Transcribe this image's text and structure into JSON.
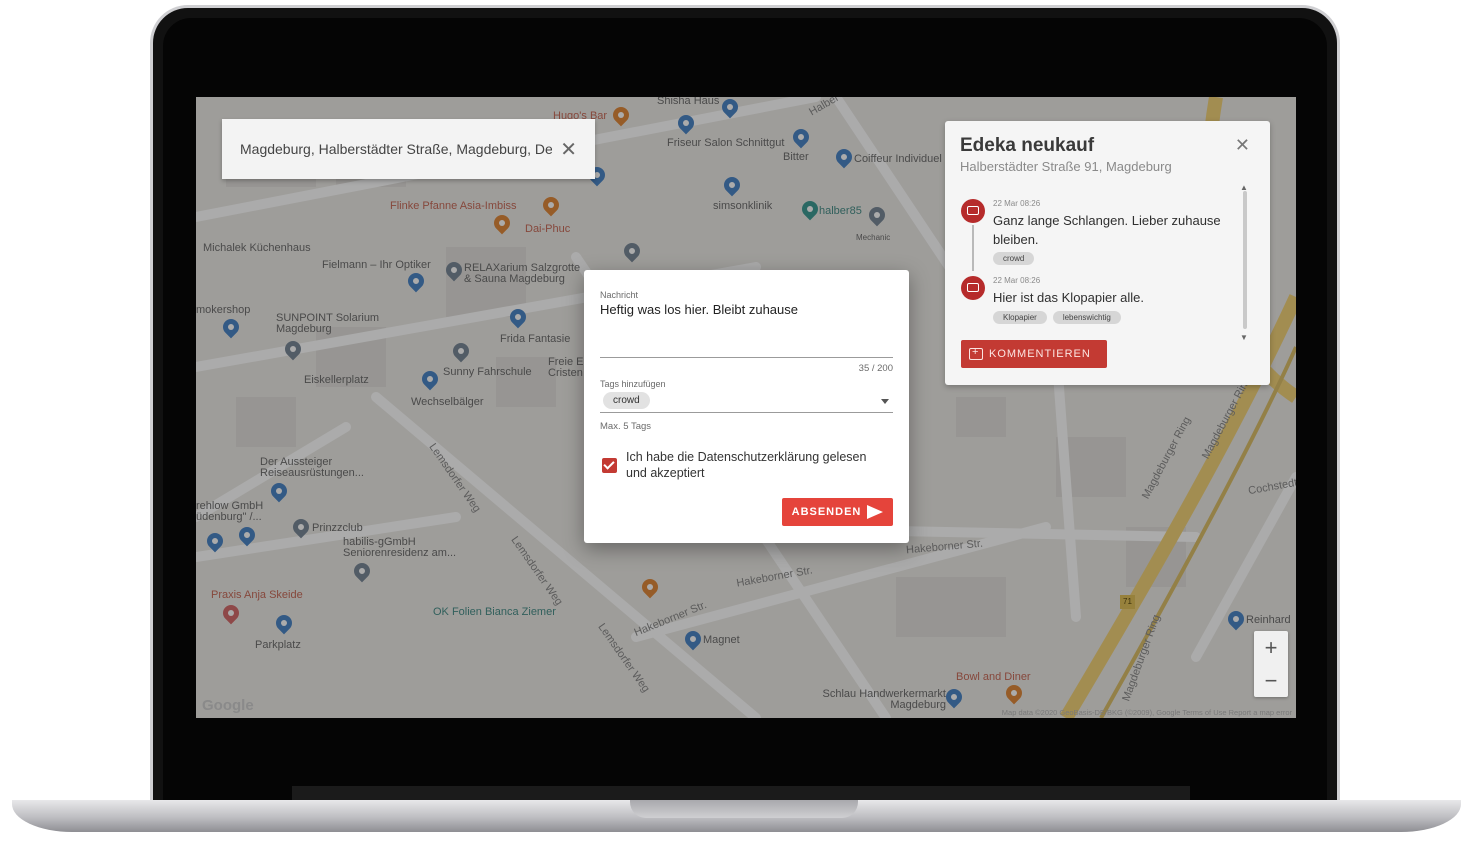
{
  "search": {
    "value": "Magdeburg, Halberstädter Straße, Magdeburg, Deutschland"
  },
  "place_panel": {
    "title": "Edeka neukauf",
    "address": "Halberstädter Straße 91, Magdeburg",
    "comments": [
      {
        "time": "22 Mar 08:26",
        "text": "Ganz lange Schlangen. Lieber zuhause bleiben.",
        "tags": [
          "crowd"
        ]
      },
      {
        "time": "22 Mar 08:26",
        "text": "Hier ist das Klopapier alle.",
        "tags": [
          "Klopapier",
          "lebenswichtig"
        ]
      }
    ],
    "comment_button": "KOMMENTIEREN"
  },
  "dialog": {
    "message_label": "Nachricht",
    "message_value": "Heftig was los hier. Bleibt zuhause",
    "char_count": "35 / 200",
    "tags_label": "Tags hinzufügen",
    "selected_tags": [
      "crowd"
    ],
    "tags_hint": "Max. 5 Tags",
    "consent_label": "Ich habe die Datenschutzerklärung gelesen und akzeptiert",
    "consent_checked": true,
    "submit_label": "ABSENDEN"
  },
  "map": {
    "labels": [
      "Hugo's Bar",
      "Shisha Haus",
      "Friseur Salon Schnittgut",
      "Bitter",
      "Coiffeur Individuel",
      "Flinke Pfanne Asia-Imbiss",
      "Dai-Phuc",
      "simsonklinik",
      "halber85",
      "Mechanic",
      "Michalek Küchenhaus",
      "Fielmann – Ihr Optiker",
      "RELAXarium Salzgrotte & Sauna Magdeburg",
      "mokershop",
      "SUNPOINT Solarium Magdeburg",
      "Frida Fantasie",
      "Eiskellerplatz",
      "Sunny Fahrschule",
      "Wechselbälger",
      "Freie E Cristen",
      "Der Aussteiger Reiseausrüstungen...",
      "rehlow GmbH üdenburg\" /...",
      "Prinzzclub",
      "habilis-gGmbH Seniorenresidenz am...",
      "Praxis Anja Skeide",
      "Parkplatz",
      "OK Folien Bianca Ziemer",
      "Magnet",
      "Bowl and Diner",
      "Schlau Handwerkermarkt Magdeburg",
      "Reinhard",
      "Lemsdorfer Weg",
      "Hakeborner Str.",
      "Magdeburger Ring",
      "Cochstedt",
      "Halber",
      "71"
    ],
    "zoom_in": "+",
    "zoom_out": "−",
    "google_logo": "Google",
    "footer": "Map data ©2020 GeoBasis-DE/BKG (©2009), Google   Terms of Use   Report a map error"
  },
  "colors": {
    "accent": "#e5443b",
    "accent_dark": "#c33a33",
    "map_bg": "#eceae6",
    "pin_blue": "#4d86c6",
    "pin_orange": "#e08a3c"
  }
}
